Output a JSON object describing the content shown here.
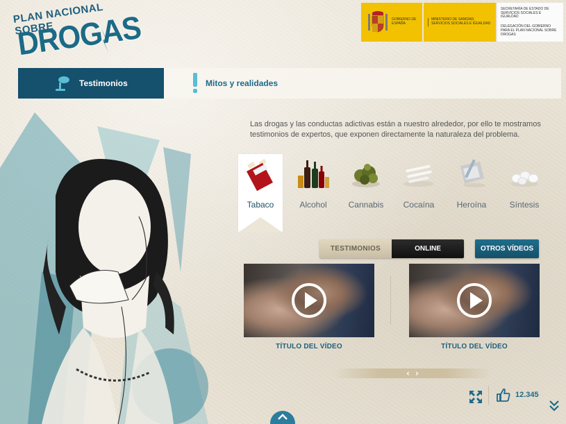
{
  "logo": {
    "line1": "PLAN NACIONAL SOBRE",
    "line2": "DROGAS"
  },
  "gov": {
    "block1": "GOBIERNO DE ESPAÑA",
    "block2": "MINISTERIO DE SANIDAD, SERVICIOS SOCIALES E IGUALDAD",
    "block3a": "SECRETARÍA DE ESTADO DE SERVICIOS SOCIALES E IGUALDAD",
    "block3b": "DELEGACIÓN DEL GOBIERNO PARA EL PLAN NACIONAL SOBRE DROGAS"
  },
  "tabs": [
    {
      "label": "Testimonios",
      "active": true
    },
    {
      "label": "Mitos y realidades",
      "active": false
    }
  ],
  "intro": "Las drogas y las conductas adictivas están a nuestro alrededor, por ello te mostramos testimonios de expertos, que exponen directamente la naturaleza del problema.",
  "categories": [
    {
      "label": "Tabaco",
      "icon": "cigarette-pack-icon",
      "active": true
    },
    {
      "label": "Alcohol",
      "icon": "bottles-icon",
      "active": false
    },
    {
      "label": "Cannabis",
      "icon": "cannabis-icon",
      "active": false
    },
    {
      "label": "Cocaína",
      "icon": "powder-lines-icon",
      "active": false
    },
    {
      "label": "Heroína",
      "icon": "foil-syringe-icon",
      "active": false
    },
    {
      "label": "Síntesis",
      "icon": "pills-icon",
      "active": false
    }
  ],
  "toggle": {
    "option1": "TESTIMONIOS",
    "option2": "ONLINE",
    "selected": "TESTIMONIOS"
  },
  "others_button": "OTROS VÍDEOS",
  "videos": [
    {
      "title": "TÍTULO DEL VÍDEO"
    },
    {
      "title": "TÍTULO DEL VÍDEO"
    }
  ],
  "pager": {
    "prev": "‹",
    "next": "›"
  },
  "likes": "12.345",
  "colors": {
    "brand_blue": "#15506c",
    "accent_blue": "#1d6a88",
    "gov_yellow": "#f2c100",
    "background": "#ece6d8"
  }
}
